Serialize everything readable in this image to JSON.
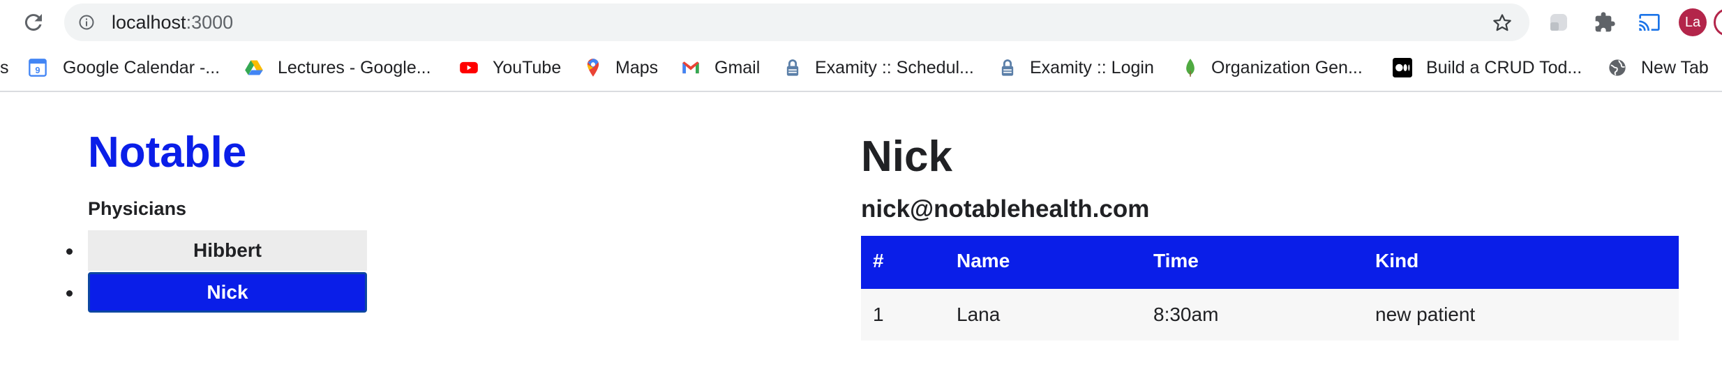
{
  "browser": {
    "url_host": "localhost",
    "url_port": ":3000",
    "profile_initials": "La",
    "icons": [
      "reload-icon",
      "site-info-icon",
      "bookmark-star-icon",
      "extension-icon",
      "puzzle-icon",
      "cast-icon"
    ]
  },
  "bookmarks": [
    {
      "label": "s",
      "icon": "truncated"
    },
    {
      "label": "Google Calendar -...",
      "icon": "calendar-icon"
    },
    {
      "label": "Lectures - Google...",
      "icon": "drive-icon"
    },
    {
      "label": "YouTube",
      "icon": "youtube-icon"
    },
    {
      "label": "Maps",
      "icon": "maps-pin-icon"
    },
    {
      "label": "Gmail",
      "icon": "gmail-icon"
    },
    {
      "label": "Examity :: Schedul...",
      "icon": "lock-icon"
    },
    {
      "label": "Examity :: Login",
      "icon": "lock-icon"
    },
    {
      "label": "Organization Gen...",
      "icon": "mongodb-leaf-icon"
    },
    {
      "label": "Build a CRUD Tod...",
      "icon": "medium-icon"
    },
    {
      "label": "New Tab",
      "icon": "globe-icon"
    }
  ],
  "app": {
    "brand": "Notable",
    "physicians_heading": "Physicians",
    "physicians": [
      {
        "name": "Hibbert",
        "selected": false
      },
      {
        "name": "Nick",
        "selected": true
      }
    ],
    "selected": {
      "name": "Nick",
      "email": "nick@notablehealth.com"
    },
    "table": {
      "headers": [
        "#",
        "Name",
        "Time",
        "Kind"
      ],
      "rows": [
        [
          "1",
          "Lana",
          "8:30am",
          "new patient"
        ]
      ]
    }
  },
  "colors": {
    "accent": "#0a1ee8",
    "idle_button": "#ececec",
    "row_bg": "#f7f7f7",
    "text": "#202124"
  }
}
